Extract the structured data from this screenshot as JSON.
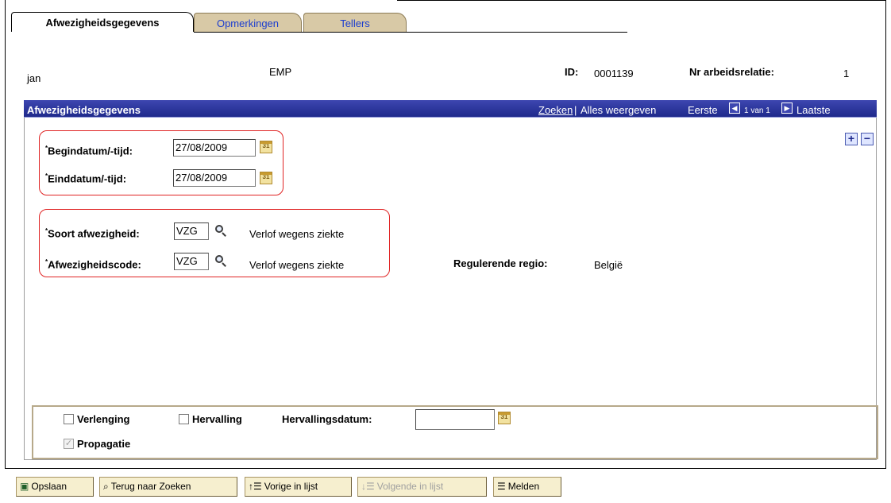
{
  "tabs": [
    {
      "label": "Afwezigheidsgegevens",
      "active": true
    },
    {
      "label": "Opmerkingen",
      "active": false
    },
    {
      "label": "Tellers",
      "active": false
    }
  ],
  "header": {
    "name": "jan",
    "type": "EMP",
    "id_label": "ID:",
    "id_value": "0001139",
    "relation_label": "Nr arbeidsrelatie:",
    "relation_value": "1"
  },
  "grid": {
    "title": "Afwezigheidsgegevens",
    "search_link": "Zoeken",
    "separator": "|",
    "show_all": "Alles weergeven",
    "first": "Eerste",
    "position": "1 van 1",
    "last": "Laatste",
    "prev_icon": "left-arrow-icon",
    "next_icon": "right-arrow-icon",
    "add_icon": "+",
    "remove_icon": "−"
  },
  "fields": {
    "begin_label": "Begindatum/-tijd:",
    "begin_value": "27/08/2009",
    "end_label": "Einddatum/-tijd:",
    "end_value": "27/08/2009",
    "absence_type_label": "Soort afwezigheid:",
    "absence_type_value": "VZG",
    "absence_type_desc": "Verlof wegens ziekte",
    "absence_code_label": "Afwezigheidscode:",
    "absence_code_value": "VZG",
    "absence_code_desc": "Verlof wegens ziekte",
    "region_label": "Regulerende regio:",
    "region_value": "België",
    "required_mark": "*",
    "calendar_icon_text": "31"
  },
  "options": {
    "extension_label": "Verlenging",
    "extension_checked": false,
    "relapse_label": "Hervalling",
    "relapse_checked": false,
    "relapse_date_label": "Hervallingsdatum:",
    "relapse_date_value": "",
    "propagation_label": "Propagatie",
    "propagation_checked": true,
    "propagation_disabled": true
  },
  "toolbar": {
    "save": "Opslaan",
    "back_to_search": "Terug naar Zoeken",
    "previous": "Vorige in lijst",
    "next": "Volgende in lijst",
    "notify": "Melden"
  },
  "colors": {
    "grid_header": "#2a349e",
    "tab_inactive": "#d8c9a6",
    "highlight_box": "#e02424",
    "link": "#1a3ccf"
  }
}
